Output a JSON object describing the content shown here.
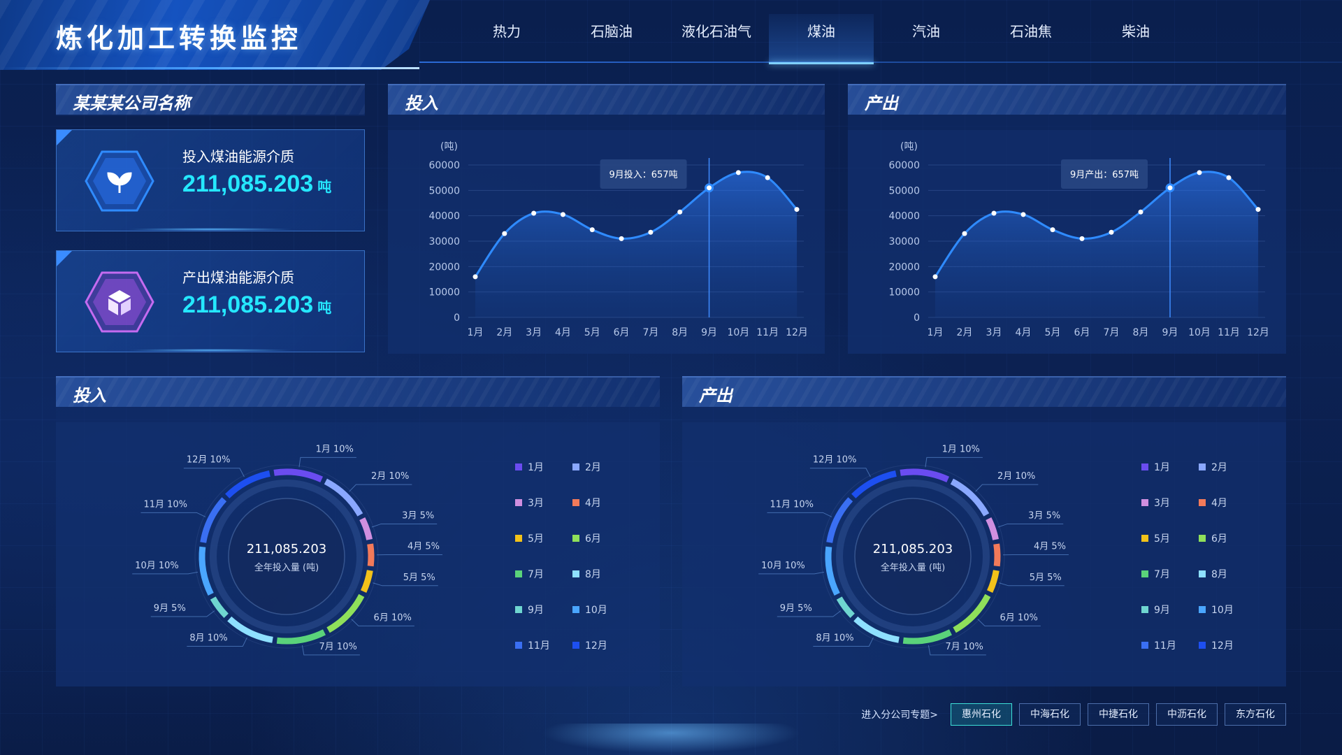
{
  "header": {
    "title": "炼化加工转换监控",
    "tabs": [
      "热力",
      "石脑油",
      "液化石油气",
      "煤油",
      "汽油",
      "石油焦",
      "柴油"
    ],
    "active_tab": 3
  },
  "company": {
    "title": "某某某公司名称",
    "input": {
      "label": "投入煤油能源介质",
      "value": "211,085.203",
      "unit": "吨",
      "icon": "leaf-icon"
    },
    "output": {
      "label": "产出煤油能源介质",
      "value": "211,085.203",
      "unit": "吨",
      "icon": "cube-icon"
    }
  },
  "line_input": {
    "title": "投入",
    "tooltip": "9月投入：657吨"
  },
  "line_output": {
    "title": "产出",
    "tooltip": "9月产出：657吨"
  },
  "pie_input": {
    "title": "投入",
    "center_value": "211,085.203",
    "center_label": "全年投入量 (吨)"
  },
  "pie_output": {
    "title": "产出",
    "center_value": "211,085.203",
    "center_label": "全年投入量 (吨)"
  },
  "footer": {
    "label": "进入分公司专题>",
    "buttons": [
      "惠州石化",
      "中海石化",
      "中捷石化",
      "中沥石化",
      "东方石化"
    ],
    "active": 0
  },
  "colors": {
    "accent": "#25e8ff",
    "line": "#2f8bff"
  },
  "chart_data": [
    {
      "type": "line",
      "title": "投入",
      "ylabel": "(吨)",
      "categories": [
        "1月",
        "2月",
        "3月",
        "4月",
        "5月",
        "6月",
        "7月",
        "8月",
        "9月",
        "10月",
        "11月",
        "12月"
      ],
      "values": [
        16000,
        33000,
        41000,
        40500,
        34500,
        31000,
        33500,
        41500,
        51000,
        57000,
        55000,
        42500
      ],
      "ylim": [
        0,
        60000
      ],
      "yticks": [
        0,
        10000,
        20000,
        30000,
        40000,
        50000,
        60000
      ],
      "highlight_index": 8
    },
    {
      "type": "line",
      "title": "产出",
      "ylabel": "(吨)",
      "categories": [
        "1月",
        "2月",
        "3月",
        "4月",
        "5月",
        "6月",
        "7月",
        "8月",
        "9月",
        "10月",
        "11月",
        "12月"
      ],
      "values": [
        16000,
        33000,
        41000,
        40500,
        34500,
        31000,
        33500,
        41500,
        51000,
        57000,
        55000,
        42500
      ],
      "ylim": [
        0,
        60000
      ],
      "yticks": [
        0,
        10000,
        20000,
        30000,
        40000,
        50000,
        60000
      ],
      "highlight_index": 8
    },
    {
      "type": "pie",
      "title": "投入",
      "categories": [
        "1月",
        "2月",
        "3月",
        "4月",
        "5月",
        "6月",
        "7月",
        "8月",
        "9月",
        "10月",
        "11月",
        "12月"
      ],
      "percents": [
        10,
        10,
        5,
        5,
        5,
        10,
        10,
        10,
        5,
        10,
        10,
        10
      ],
      "labels": [
        "1月  10%",
        "2月  10%",
        "3月  5%",
        "4月  5%",
        "5月  5%",
        "6月  10%",
        "7月  10%",
        "8月  10%",
        "9月  5%",
        "10月  10%",
        "11月  10%",
        "12月  10%"
      ],
      "colors": [
        "#6a4cf0",
        "#8aa8ff",
        "#d08fe0",
        "#f27a5a",
        "#f2c21a",
        "#8fe05a",
        "#5ad37a",
        "#8ee0ff",
        "#6fd6d0",
        "#4aa6ff",
        "#3a6ff2",
        "#1d4ff0"
      ]
    },
    {
      "type": "pie",
      "title": "产出",
      "categories": [
        "1月",
        "2月",
        "3月",
        "4月",
        "5月",
        "6月",
        "7月",
        "8月",
        "9月",
        "10月",
        "11月",
        "12月"
      ],
      "percents": [
        10,
        10,
        5,
        5,
        5,
        10,
        10,
        10,
        5,
        10,
        10,
        10
      ],
      "labels": [
        "1月  10%",
        "2月  10%",
        "3月  5%",
        "4月  5%",
        "5月  5%",
        "6月  10%",
        "7月  10%",
        "8月  10%",
        "9月  5%",
        "10月  10%",
        "11月  10%",
        "12月  10%"
      ],
      "colors": [
        "#6a4cf0",
        "#8aa8ff",
        "#d08fe0",
        "#f27a5a",
        "#f2c21a",
        "#8fe05a",
        "#5ad37a",
        "#8ee0ff",
        "#6fd6d0",
        "#4aa6ff",
        "#3a6ff2",
        "#1d4ff0"
      ]
    }
  ]
}
